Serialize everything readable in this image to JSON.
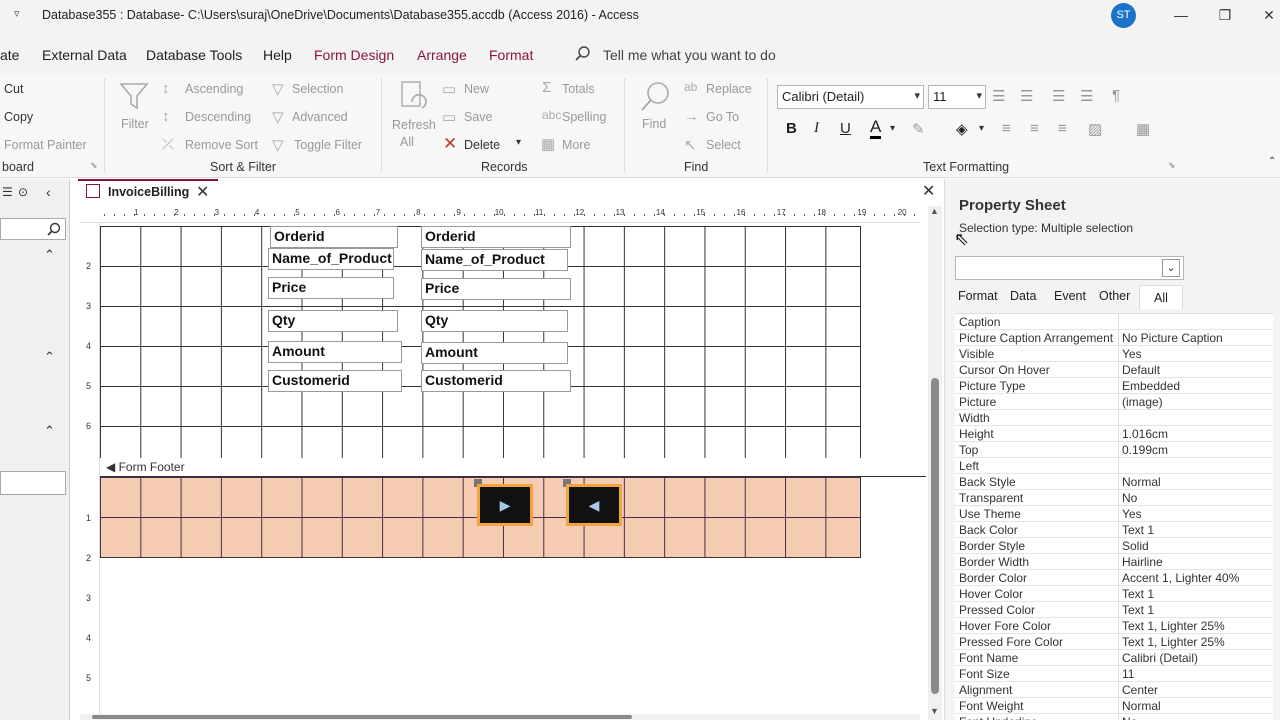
{
  "window": {
    "title": "Database355 : Database- C:\\Users\\suraj\\OneDrive\\Documents\\Database355.accdb (Access 2016)  -  Access",
    "avatar_initials": "ST",
    "minimize": "—",
    "restore": "❐",
    "close": "✕"
  },
  "menu_tabs": [
    "ate",
    "External Data",
    "Database Tools",
    "Help",
    "Form Design",
    "Arrange",
    "Format"
  ],
  "tell_me": "Tell me what you want to do",
  "ribbon": {
    "clipboard": {
      "cut": "Cut",
      "copy": "Copy",
      "format_painter": "Format Painter",
      "group": "board"
    },
    "sort_filter": {
      "filter": "Filter",
      "ascending": "Ascending",
      "descending": "Descending",
      "remove_sort": "Remove Sort",
      "selection": "Selection",
      "advanced": "Advanced",
      "toggle_filter": "Toggle Filter",
      "group": "Sort & Filter"
    },
    "records": {
      "refresh": "Refresh",
      "refresh_all": "All",
      "new": "New",
      "save": "Save",
      "delete": "Delete",
      "totals": "Totals",
      "spelling": "Spelling",
      "more": "More",
      "group": "Records"
    },
    "find": {
      "find": "Find",
      "replace": "Replace",
      "go_to": "Go To",
      "select": "Select",
      "group": "Find"
    },
    "text_formatting": {
      "font": "Calibri (Detail)",
      "size": "11",
      "group": "Text Formatting",
      "bold": "B",
      "italic": "I",
      "underline": "U",
      "font_color": "A"
    }
  },
  "document": {
    "tab": "InvoiceBilling",
    "form_footer": "Form Footer",
    "labels": [
      "Orderid",
      "Name_of_Product",
      "Price",
      "Qty",
      "Amount",
      "Customerid"
    ],
    "fields": [
      "Orderid",
      "Name_of_Product",
      "Price",
      "Qty",
      "Amount",
      "Customerid"
    ],
    "ruler_ticks": [
      "1",
      "2",
      "3",
      "4",
      "5",
      "6",
      "7",
      "8",
      "9",
      "10",
      "11",
      "12",
      "13",
      "14",
      "15",
      "16",
      "17",
      "18",
      "19",
      "20"
    ],
    "vruler_detail": [
      "2",
      "3",
      "4",
      "5",
      "6"
    ],
    "vruler_footer": [
      "1",
      "2",
      "3",
      "4",
      "5"
    ],
    "next_glyph": "▶",
    "prev_glyph": "◀"
  },
  "property_sheet": {
    "title": "Property Sheet",
    "selection_type": "Selection type:  Multiple selection",
    "tabs": [
      "Format",
      "Data",
      "Event",
      "Other",
      "All"
    ],
    "active_tab": "All",
    "rows": [
      [
        "Caption",
        ""
      ],
      [
        "Picture Caption Arrangement",
        "No Picture Caption"
      ],
      [
        "Visible",
        "Yes"
      ],
      [
        "Cursor On Hover",
        "Default"
      ],
      [
        "Picture Type",
        "Embedded"
      ],
      [
        "Picture",
        "(image)"
      ],
      [
        "Width",
        ""
      ],
      [
        "Height",
        "1.016cm"
      ],
      [
        "Top",
        "0.199cm"
      ],
      [
        "Left",
        ""
      ],
      [
        "Back Style",
        "Normal"
      ],
      [
        "Transparent",
        "No"
      ],
      [
        "Use Theme",
        "Yes"
      ],
      [
        "Back Color",
        "Text 1"
      ],
      [
        "Border Style",
        "Solid"
      ],
      [
        "Border Width",
        "Hairline"
      ],
      [
        "Border Color",
        "Accent 1, Lighter 40%"
      ],
      [
        "Hover Color",
        "Text 1"
      ],
      [
        "Pressed Color",
        "Text 1"
      ],
      [
        "Hover Fore Color",
        "Text 1, Lighter 25%"
      ],
      [
        "Pressed Fore Color",
        "Text 1, Lighter 25%"
      ],
      [
        "Font Name",
        "Calibri (Detail)"
      ],
      [
        "Font Size",
        "11"
      ],
      [
        "Alignment",
        "Center"
      ],
      [
        "Font Weight",
        "Normal"
      ],
      [
        "Font Underline",
        "No"
      ]
    ]
  },
  "colors": {
    "context_tab": "#8b1538",
    "footer_bg": "#f5cbb1",
    "selection": "#f2a33c"
  }
}
